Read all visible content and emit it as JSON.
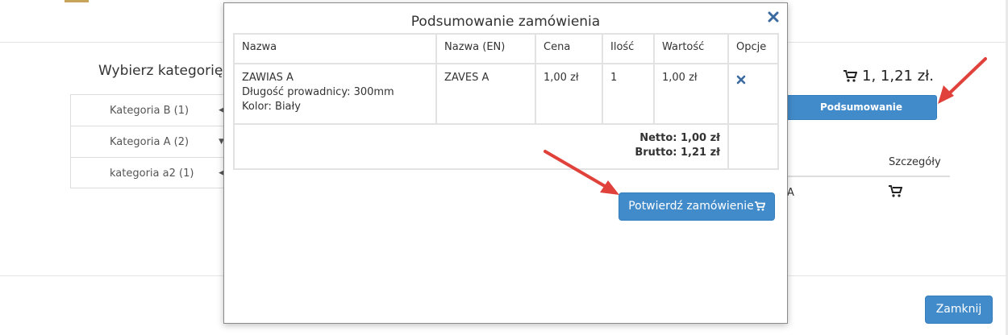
{
  "background": {
    "category_title": "Wybierz kategorię",
    "categories": [
      {
        "label": "Kategoria B (1)"
      },
      {
        "label": "Kategoria A (2)"
      },
      {
        "label": "kategoria a2 (1)"
      }
    ],
    "cart_total": "1, 1,21 zł.",
    "summary_button": "Podsumowanie zamówienia",
    "details_header": "Szczegóły",
    "row_fragment": "A",
    "close_button": "Zamknij"
  },
  "modal": {
    "title": "Podsumowanie zamówienia",
    "columns": [
      "Nazwa",
      "Nazwa (EN)",
      "Cena",
      "Ilość",
      "Wartość",
      "Opcje"
    ],
    "rows": [
      {
        "name": "ZAWIAS A",
        "detail1": "Długość prowadnicy: 300mm",
        "detail2": "Kolor: Biały",
        "name_en": "ZAVES A",
        "price": "1,00 zł",
        "qty": "1",
        "value": "1,00 zł"
      }
    ],
    "netto": "Netto: 1,00 zł",
    "brutto": "Brutto: 1,21 zł",
    "confirm_button": "Potwierdź zamówienie"
  },
  "colors": {
    "primary": "#428bca",
    "annotation": "#e0413a",
    "close_icon": "#3b6aa0"
  },
  "icons": [
    "cart-icon",
    "cart-icon",
    "close-icon",
    "delete-icon",
    "cart-icon"
  ]
}
